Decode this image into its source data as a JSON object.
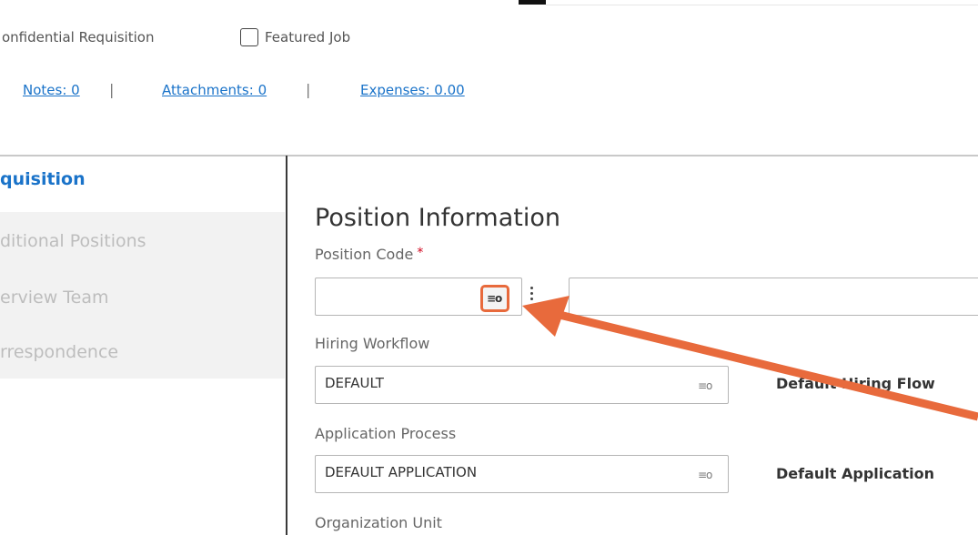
{
  "options": {
    "confidential_label": "onfidential Requisition",
    "featured_label": "Featured Job"
  },
  "links": {
    "notes": "Notes: 0",
    "attachments": "Attachments: 0",
    "expenses": "Expenses: 0.00",
    "separator": "|"
  },
  "sidebar": {
    "active": "quisition",
    "items": [
      {
        "label": "ditional Positions"
      },
      {
        "label": "erview Team"
      },
      {
        "label": "rrespondence"
      }
    ]
  },
  "main": {
    "section_title": "Position Information",
    "position_code": {
      "label": "Position Code",
      "required_mark": "*",
      "value": "",
      "description": ""
    },
    "hiring_workflow": {
      "label": "Hiring Workflow",
      "value": "DEFAULT",
      "description": "Default Hiring Flow"
    },
    "application_process": {
      "label": "Application Process",
      "value": "DEFAULT APPLICATION",
      "description": "Default Application"
    },
    "organization_unit": {
      "label": "Organization Unit"
    }
  },
  "icons": {
    "lookup_icon": "≡o",
    "annotation_color": "#e86a3c",
    "link_color": "#1a73c9"
  }
}
